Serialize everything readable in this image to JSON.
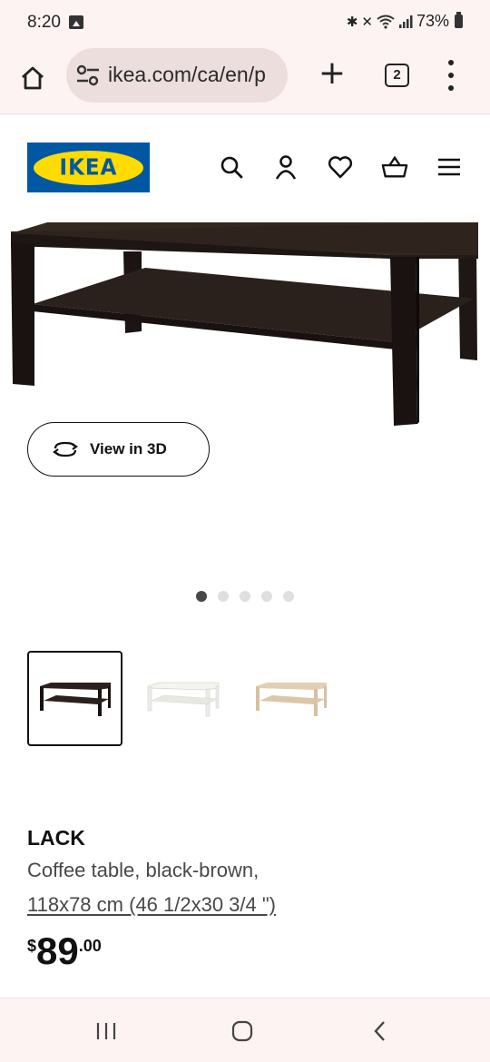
{
  "status_bar": {
    "time": "8:20",
    "battery": "73%",
    "icons": [
      "gallery-icon",
      "bluetooth-icon",
      "mute-icon",
      "wifi-icon",
      "signal-icon",
      "battery-icon"
    ]
  },
  "browser": {
    "url": "ikea.com/ca/en/p",
    "tab_count": "2",
    "icons": [
      "home-icon",
      "site-settings-icon",
      "new-tab-icon",
      "tabs-icon",
      "more-icon"
    ]
  },
  "site_header": {
    "logo_text": "IKEA",
    "icons": [
      "search-icon",
      "account-icon",
      "heart-icon",
      "shopping-basket-icon",
      "hamburger-menu-icon"
    ]
  },
  "gallery": {
    "view3d_label": "View in 3D",
    "image_count": 5,
    "active_index": 0
  },
  "variants": [
    {
      "name": "black-brown",
      "color": "#2b211c",
      "selected": true
    },
    {
      "name": "white",
      "color": "#f2f2ee",
      "selected": false
    },
    {
      "name": "white stained oak effect",
      "color": "#ddc8ad",
      "selected": false
    }
  ],
  "product": {
    "name": "LACK",
    "description": "Coffee table, black-brown,",
    "size": "118x78 cm (46 1/2x30 3/4 \")",
    "price_currency": "$",
    "price_whole": "89",
    "price_cents": ".00"
  },
  "colors": {
    "chrome_bg": "#fdf3f3",
    "ikea_blue": "#0058a3",
    "ikea_yellow": "#ffdb00",
    "table_dark": "#2b211c"
  }
}
